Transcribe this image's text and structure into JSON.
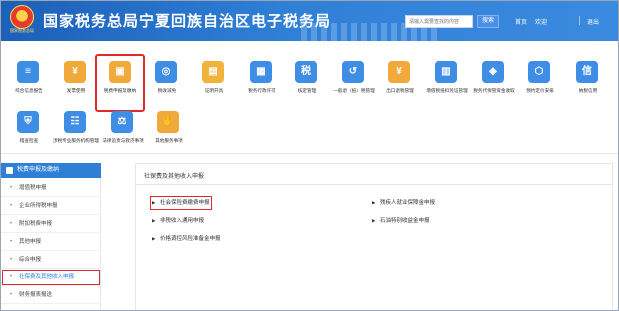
{
  "header": {
    "emblem_caption": "国家税务总局",
    "title": "国家税务总局宁夏回族自治区电子税务局",
    "search": {
      "placeholder": "请输入需要查找的内容",
      "button": "搜索"
    },
    "links": {
      "home": "首页",
      "welcome": "欢迎",
      "logout": "退出"
    }
  },
  "functions": [
    {
      "label": "综合信息报告",
      "icon": "report-icon",
      "color": "#3f8ee6",
      "glyph": "≡"
    },
    {
      "label": "发票使用",
      "icon": "invoice-icon",
      "color": "#f0a93a",
      "glyph": "¥"
    },
    {
      "label": "税费申报及缴纳",
      "icon": "tax-declare-icon",
      "color": "#f0a93a",
      "glyph": "▣"
    },
    {
      "label": "税收减免",
      "icon": "tax-reduction-icon",
      "color": "#3f8ee6",
      "glyph": "◎"
    },
    {
      "label": "证明开具",
      "icon": "certificate-icon",
      "color": "#f2b23e",
      "glyph": "▤"
    },
    {
      "label": "税务行政许可",
      "icon": "license-icon",
      "color": "#3f8ee6",
      "glyph": "▦"
    },
    {
      "label": "核定管理",
      "icon": "approval-icon",
      "color": "#3f8ee6",
      "glyph": "税"
    },
    {
      "label": "一般退（抵）税管理",
      "icon": "refund-icon",
      "color": "#3f8ee6",
      "glyph": "↺"
    },
    {
      "label": "出口退税管理",
      "icon": "export-refund-icon",
      "color": "#f0a93a",
      "glyph": "¥"
    },
    {
      "label": "增值税抵扣凭证管理",
      "icon": "vat-deduction-icon",
      "color": "#3f8ee6",
      "glyph": "▥"
    },
    {
      "label": "税务代保管资金收取",
      "icon": "custody-icon",
      "color": "#3f8ee6",
      "glyph": "◈"
    },
    {
      "label": "预约定价安排",
      "icon": "pricing-icon",
      "color": "#3f8ee6",
      "glyph": "⬡"
    },
    {
      "label": "纳税信用",
      "icon": "credit-icon",
      "color": "#3f8ee6",
      "glyph": "信"
    },
    {
      "label": "稽查检查",
      "icon": "inspection-icon",
      "color": "#3f8ee6",
      "glyph": "⛨"
    },
    {
      "label": "涉税专业服务机构管理",
      "icon": "agency-icon",
      "color": "#3f8ee6",
      "glyph": "☷"
    },
    {
      "label": "法律追责与救济事项",
      "icon": "legal-icon",
      "color": "#3f8ee6",
      "glyph": "⚖"
    },
    {
      "label": "其他服务事项",
      "icon": "other-services-icon",
      "color": "#f0a93a",
      "glyph": "✋"
    }
  ],
  "sidebar": {
    "title": "税费申报及缴纳",
    "items": [
      "增值税申报",
      "企业所得税申报",
      "附加税费申报",
      "其他申报",
      "综合申报",
      "社保费及其他收入申报",
      "财务报表报送"
    ]
  },
  "panel": {
    "title": "社保费及其他收入申报",
    "items": [
      "社会保险费缴费申报",
      "残疾人就业保障金申报",
      "非税收入通用申报",
      "石油特别收益金申报",
      "价格调控风险准备金申报"
    ]
  },
  "colors": {
    "brand": "#2f7fd6",
    "highlight": "#e02a2a"
  }
}
